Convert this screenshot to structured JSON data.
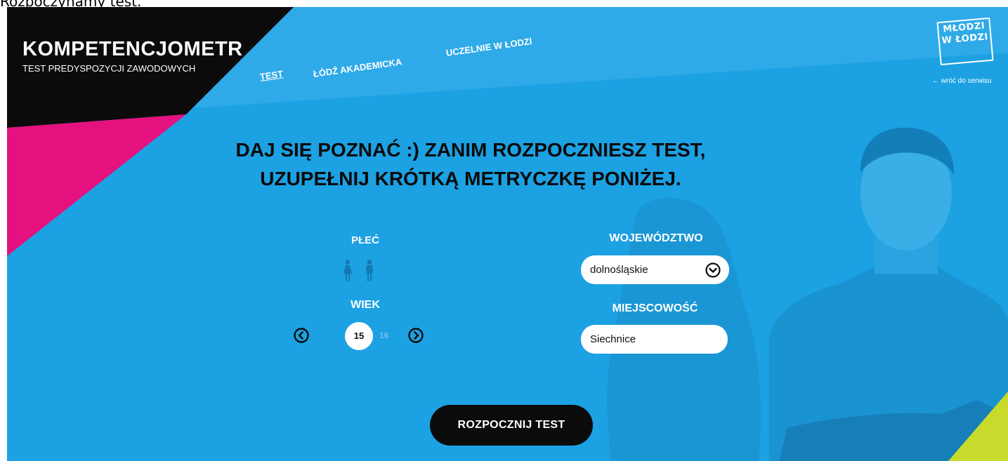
{
  "page_caption": "Rozpoczynamy test.",
  "header": {
    "brand_title": "KOMPETENCJOMETR",
    "brand_subtitle": "TEST PREDYSPOZYCJI ZAWODOWYCH",
    "nav": [
      {
        "label": "TEST",
        "active": true
      },
      {
        "label": "ŁÓDŹ AKADEMICKA",
        "active": false
      },
      {
        "label": "UCZELNIE W ŁODZI",
        "active": false
      }
    ],
    "logo_text": "MŁODZI W ŁODZI",
    "back_link": "← wróć do serwisu"
  },
  "main": {
    "headline_line1": "DAJ SIĘ POZNAĆ :) ZANIM ROZPOCZNIESZ TEST,",
    "headline_line2": "UZUPEŁNIJ KRÓTKĄ METRYCZKĘ PONIŻEJ.",
    "gender": {
      "label": "PŁEĆ",
      "options": [
        "female-icon",
        "male-icon"
      ]
    },
    "age": {
      "label": "WIEK",
      "current": "15",
      "next": "16"
    },
    "region": {
      "label": "WOJEWÓDZTWO",
      "selected": "dolnośląskie"
    },
    "city": {
      "label": "MIEJSCOWOŚĆ",
      "value": "Siechnice"
    },
    "start_button": "ROZPOCZNIJ TEST"
  },
  "colors": {
    "background": "#1ca1e3",
    "dark": "#0b0b0b",
    "magenta": "#e5117e",
    "lime": "#c8da2b"
  }
}
